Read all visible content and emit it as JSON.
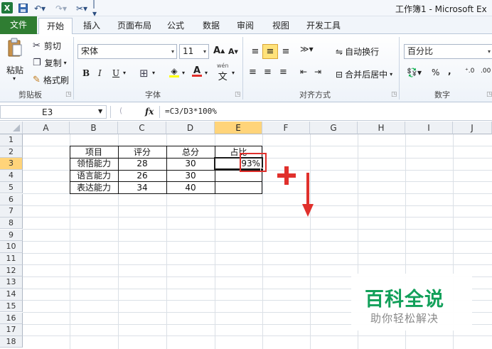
{
  "window": {
    "title": "工作簿1 - Microsoft Ex",
    "app_icon": "X"
  },
  "tabs": [
    "文件",
    "开始",
    "插入",
    "页面布局",
    "公式",
    "数据",
    "审阅",
    "视图",
    "开发工具"
  ],
  "ribbon": {
    "clipboard": {
      "paste": "粘贴",
      "cut": "剪切",
      "copy": "复制",
      "format_painter": "格式刷",
      "label": "剪贴板"
    },
    "font": {
      "name": "宋体",
      "size": "11",
      "bold": "B",
      "italic": "I",
      "underline": "U",
      "grow": "A",
      "shrink": "A",
      "wen": "wén",
      "label": "字体"
    },
    "alignment": {
      "wrap_text": "自动换行",
      "merge_center": "合并后居中",
      "label": "对齐方式"
    },
    "number": {
      "format": "百分比",
      "percent": "%",
      "comma": ",",
      "label": "数字"
    }
  },
  "formula_bar": {
    "name_box": "E3",
    "fx": "fx",
    "formula": "=C3/D3*100%"
  },
  "grid": {
    "columns": [
      "A",
      "B",
      "C",
      "D",
      "E",
      "F",
      "G",
      "H",
      "I",
      "J"
    ],
    "selected_column": "E",
    "rows": [
      "1",
      "2",
      "3",
      "4",
      "5",
      "6",
      "7",
      "8",
      "9",
      "10",
      "11",
      "12",
      "13",
      "14",
      "15",
      "16",
      "17",
      "18"
    ],
    "selected_row": "3",
    "table": {
      "headers": [
        "项目",
        "评分",
        "总分",
        "占比"
      ],
      "rows": [
        [
          "领悟能力",
          "28",
          "30",
          "93%"
        ],
        [
          "语言能力",
          "26",
          "30",
          ""
        ],
        [
          "表达能力",
          "34",
          "40",
          ""
        ]
      ]
    }
  },
  "watermark": {
    "title": "百科全说",
    "subtitle": "助你轻松解决"
  },
  "colors": {
    "file_tab": "#2f7d32",
    "annotation_red": "#e0302c",
    "selected_header": "#ffd47a"
  }
}
